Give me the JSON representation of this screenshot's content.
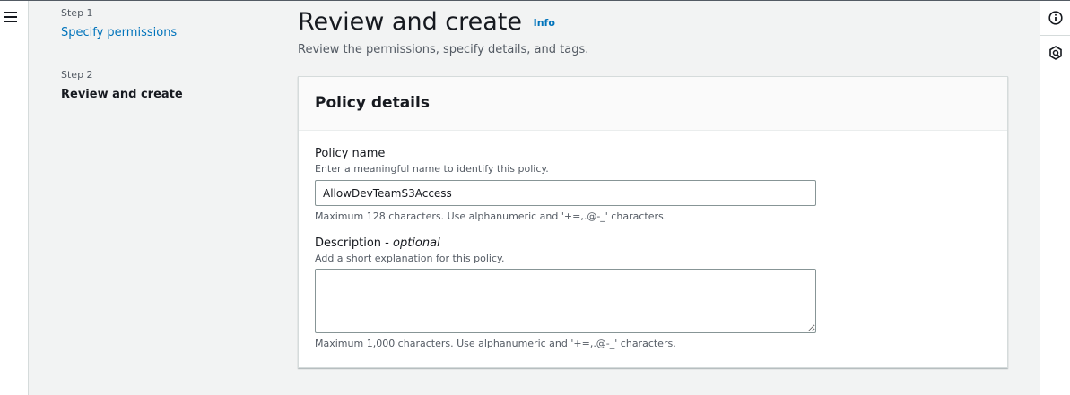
{
  "wizard": {
    "steps": [
      {
        "number_label": "Step 1",
        "title": "Specify permissions",
        "state": "link"
      },
      {
        "number_label": "Step 2",
        "title": "Review and create",
        "state": "current"
      }
    ]
  },
  "page": {
    "title": "Review and create",
    "info_link": "Info",
    "subtitle": "Review the permissions, specify details, and tags."
  },
  "policy_details": {
    "header": "Policy details",
    "name": {
      "label": "Policy name",
      "description": "Enter a meaningful name to identify this policy.",
      "value": "AllowDevTeamS3Access",
      "constraint": "Maximum 128 characters. Use alphanumeric and '+=,.@-_' characters."
    },
    "description": {
      "label": "Description - ",
      "label_optional": "optional",
      "description": "Add a short explanation for this policy.",
      "value": "",
      "constraint": "Maximum 1,000 characters. Use alphanumeric and '+=,.@-_' characters."
    }
  },
  "icons": {
    "menu": "hamburger-menu-icon",
    "info_panel": "info-circle-icon",
    "second_panel": "hexagon-badge-icon"
  },
  "colors": {
    "link": "#0073bb",
    "text": "#16191f",
    "muted": "#545b64",
    "background": "#f2f3f3"
  }
}
